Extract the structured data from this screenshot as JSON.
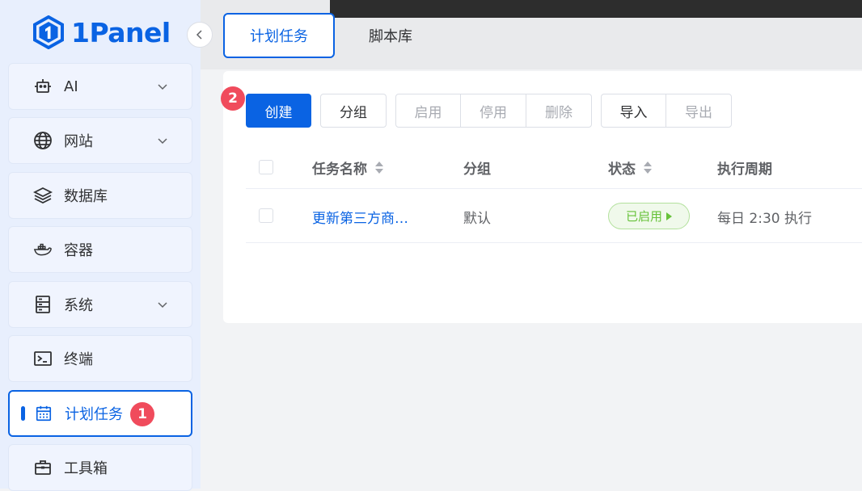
{
  "app": {
    "logo_text": "1Panel",
    "brand_color": "#0a63e3",
    "danger_badge_color": "#f04b5c"
  },
  "sidebar": {
    "items": [
      {
        "label": "AI",
        "icon": "robot-icon",
        "has_submenu": true
      },
      {
        "label": "网站",
        "icon": "globe-icon",
        "has_submenu": true
      },
      {
        "label": "数据库",
        "icon": "layers-icon",
        "has_submenu": false
      },
      {
        "label": "容器",
        "icon": "docker-whale-icon",
        "has_submenu": false
      },
      {
        "label": "系统",
        "icon": "server-icon",
        "has_submenu": true
      },
      {
        "label": "终端",
        "icon": "terminal-icon",
        "has_submenu": false
      },
      {
        "label": "计划任务",
        "icon": "calendar-icon",
        "has_submenu": false,
        "active": true
      },
      {
        "label": "工具箱",
        "icon": "toolbox-icon",
        "has_submenu": false
      }
    ]
  },
  "badges": {
    "step1": "1",
    "step2": "2"
  },
  "tabs": [
    {
      "label": "计划任务",
      "active": true
    },
    {
      "label": "脚本库",
      "active": false
    }
  ],
  "toolbar": {
    "create": "创建",
    "group": "分组",
    "enable": "启用",
    "disable": "停用",
    "delete": "删除",
    "import": "导入",
    "export": "导出"
  },
  "table": {
    "columns": [
      "任务名称",
      "分组",
      "状态",
      "执行周期"
    ],
    "rows": [
      {
        "name": "更新第三方商…",
        "group": "默认",
        "status": "已启用",
        "schedule": "每日 2:30 执行"
      }
    ]
  }
}
